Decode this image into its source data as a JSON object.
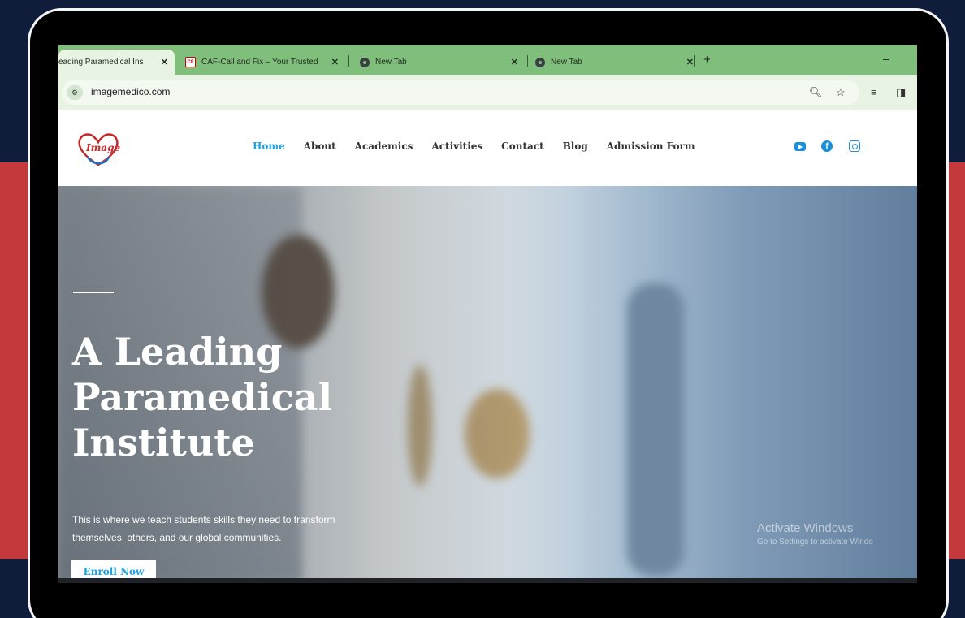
{
  "browser": {
    "tabs": [
      {
        "title": "eading Paramedical Ins",
        "close": "✕",
        "active": true
      },
      {
        "title": "CAF-Call and Fix – Your Trusted",
        "close": "✕",
        "favicon_text": "CF"
      },
      {
        "title": "New Tab",
        "close": "✕"
      },
      {
        "title": "New Tab",
        "close": "✕"
      }
    ],
    "new_tab": "+",
    "minimize": "–",
    "url": "imagemedico.com",
    "site_info_icon": "tune-icon"
  },
  "site": {
    "logo_text": "Image",
    "nav": [
      "Home",
      "About",
      "Academics",
      "Activities",
      "Contact",
      "Blog",
      "Admission Form"
    ],
    "social": [
      "youtube-icon",
      "facebook-icon",
      "instagram-icon"
    ],
    "brand_colors": {
      "accent": "#1ea0e0",
      "logo_red": "#c62828"
    }
  },
  "hero": {
    "title_line1": "A Leading",
    "title_line2": "Paramedical",
    "title_line3": "Institute",
    "subtitle_line1": "This is where we teach students skills they need to transform",
    "subtitle_line2": "themselves, others, and our global communities.",
    "button": "Enroll Now"
  },
  "watermark": {
    "line1": "Activate Windows",
    "line2": "Go to Settings to activate Windo"
  },
  "frame_colors": {
    "background": "#0f1d3b",
    "band": "#c4393c"
  }
}
